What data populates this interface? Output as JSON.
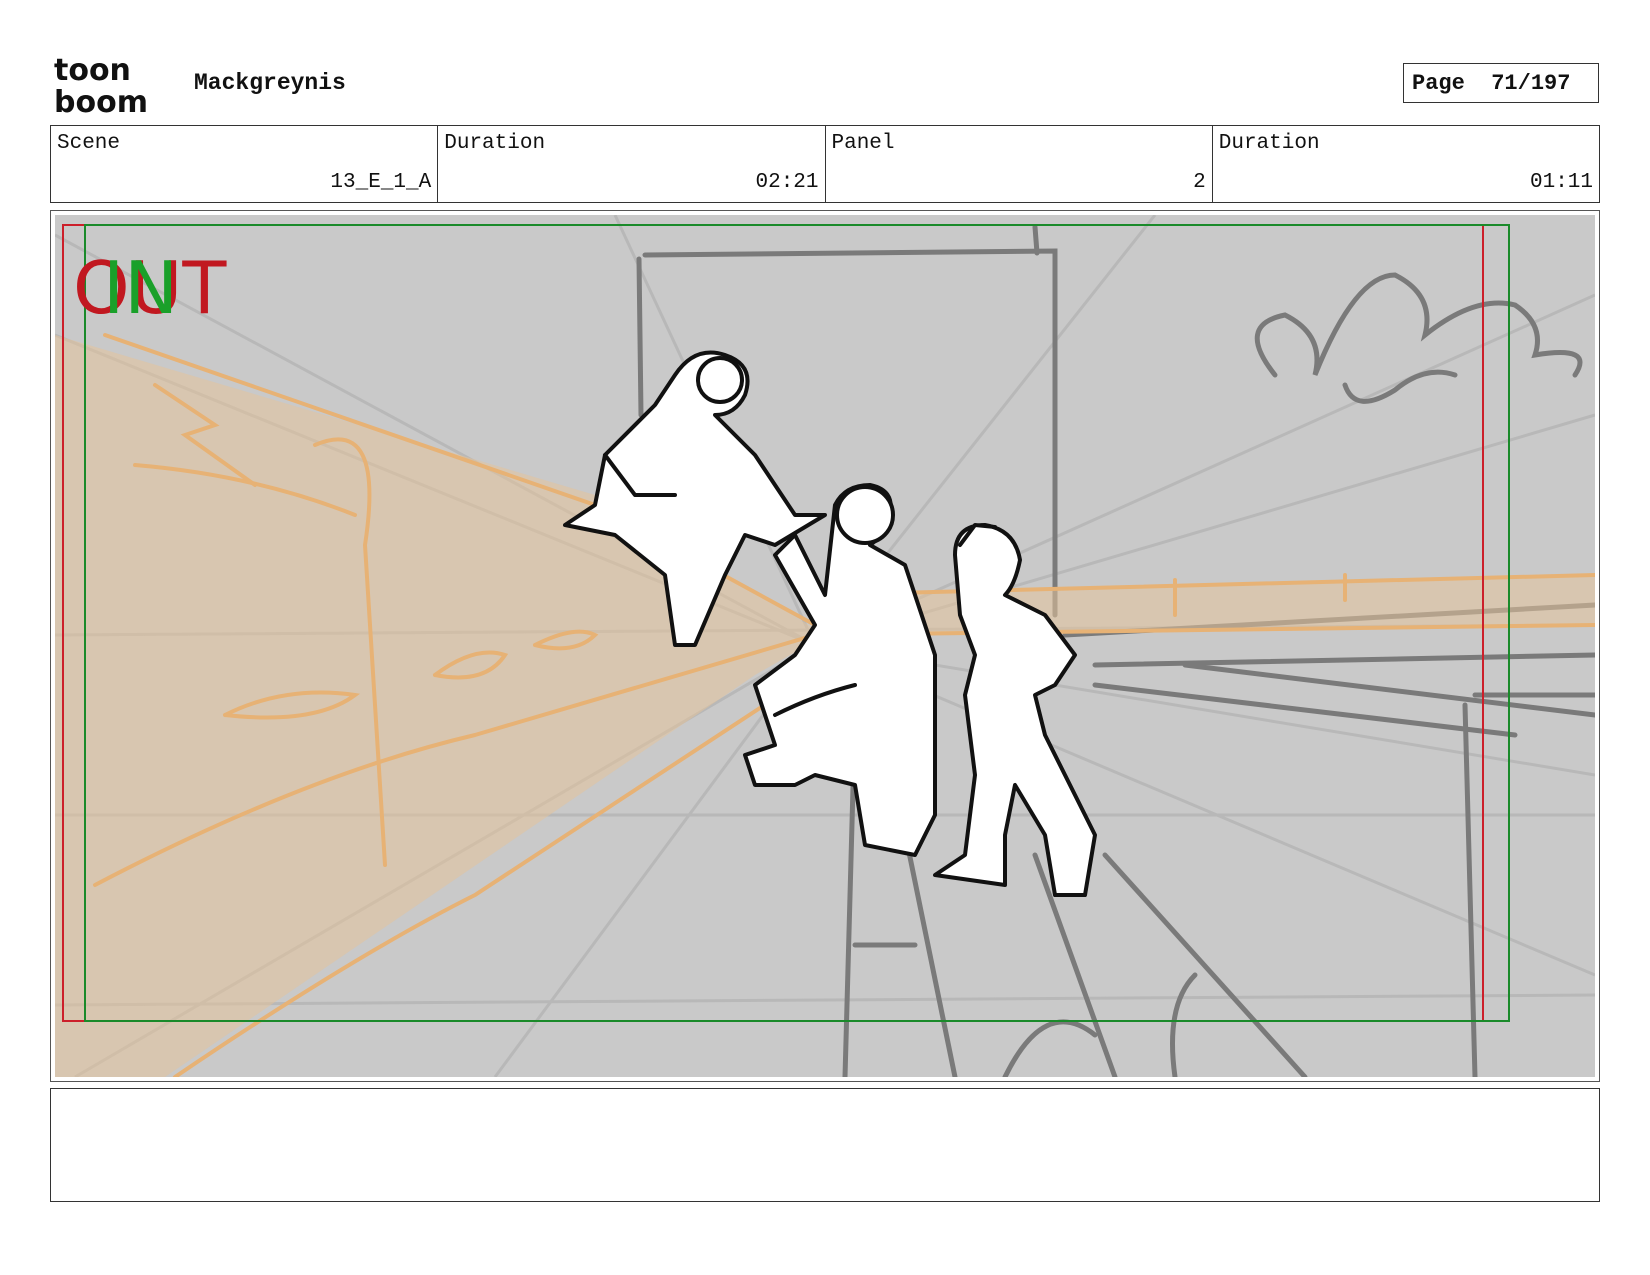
{
  "header": {
    "logo_text_top": "toon",
    "logo_text_bottom": "boom",
    "project_name": "Mackgreynis",
    "page_label": "Page",
    "page_number": "71/197"
  },
  "info": {
    "scene_label": "Scene",
    "scene_value": "13_E_1_A",
    "scene_duration_label": "Duration",
    "scene_duration_value": "02:21",
    "panel_label": "Panel",
    "panel_value": "2",
    "panel_duration_label": "Duration",
    "panel_duration_value": "01:11"
  },
  "panel": {
    "out_marker": "OUT",
    "in_marker": "IN",
    "colors": {
      "background": "#c9c9c9",
      "wall": "#e8c090",
      "out_frame": "#cc1f2a",
      "in_frame": "#1a8a2a",
      "sketch": "#777777",
      "ink": "#111111"
    }
  },
  "notes": {
    "text": ""
  }
}
